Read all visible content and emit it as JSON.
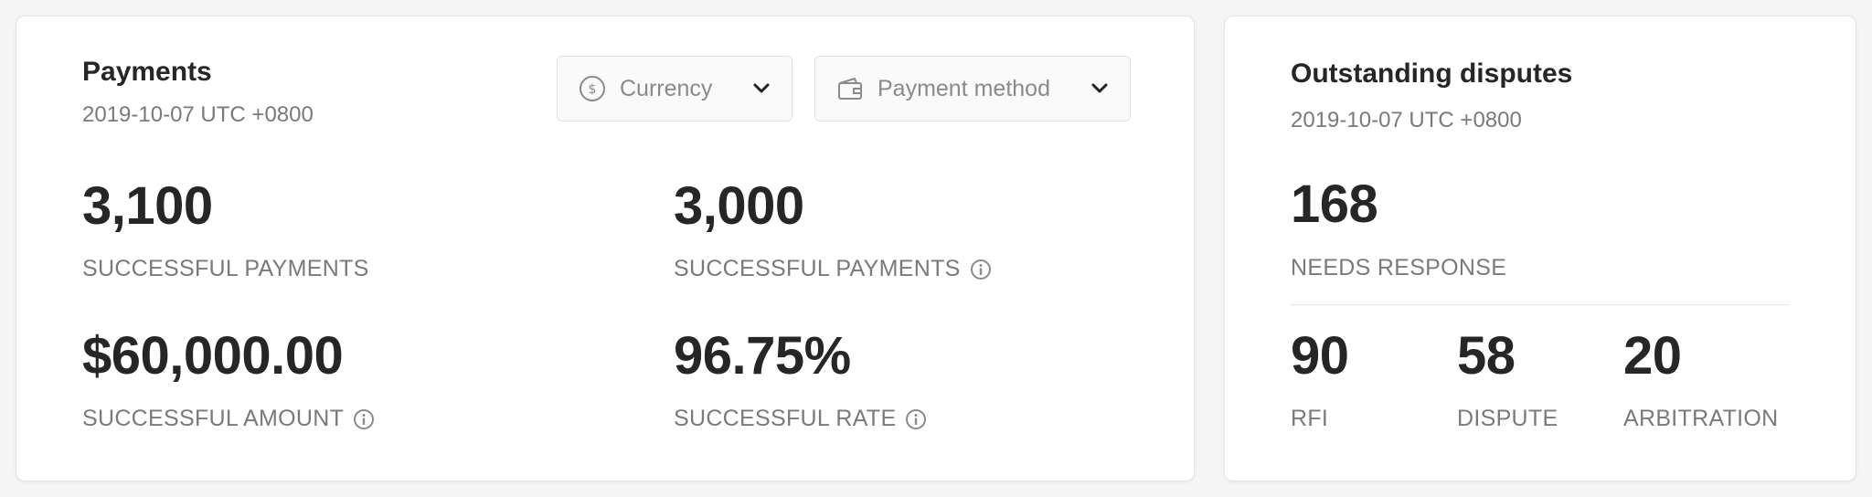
{
  "payments": {
    "title": "Payments",
    "subtitle": "2019-10-07 UTC +0800",
    "currency_dropdown": {
      "label": "Currency",
      "icon": "dollar-coin-icon"
    },
    "payment_method_dropdown": {
      "label": "Payment method",
      "icon": "wallet-icon"
    },
    "metrics": [
      {
        "value": "3,100",
        "label": "SUCCESSFUL PAYMENTS",
        "info": false
      },
      {
        "value": "3,000",
        "label": "SUCCESSFUL PAYMENTS",
        "info": true
      },
      {
        "value": "$60,000.00",
        "label": "SUCCESSFUL AMOUNT",
        "info": true
      },
      {
        "value": "96.75%",
        "label": "SUCCESSFUL RATE",
        "info": true
      }
    ]
  },
  "disputes": {
    "title": "Outstanding disputes",
    "subtitle": "2019-10-07 UTC +0800",
    "main_metric": {
      "value": "168",
      "label": "NEEDS RESPONSE"
    },
    "breakdown": [
      {
        "value": "90",
        "label": "RFI"
      },
      {
        "value": "58",
        "label": "DISPUTE"
      },
      {
        "value": "20",
        "label": "ARBITRATION"
      }
    ]
  },
  "colors": {
    "background": "#f5f5f5",
    "card": "#ffffff",
    "text_primary": "#262626",
    "text_secondary": "#7a7a7a",
    "border": "#e6e6e6"
  }
}
